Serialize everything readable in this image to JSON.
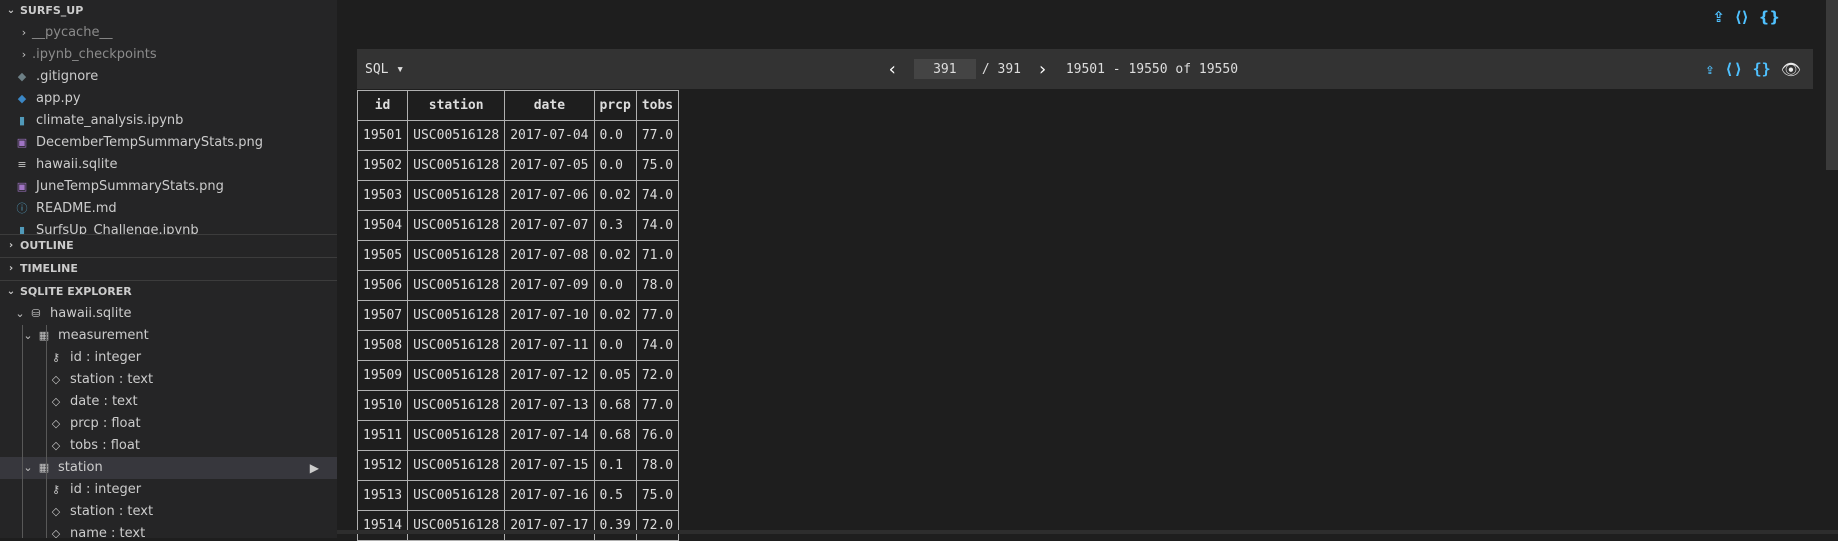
{
  "explorer": {
    "folder_title": "SURFS_UP",
    "files": [
      {
        "label": "__pycache__",
        "type": "folder",
        "icon": "chevron-right-icon"
      },
      {
        "label": ".ipynb_checkpoints",
        "type": "folder",
        "icon": "chevron-right-icon"
      },
      {
        "label": ".gitignore",
        "type": "file",
        "icon": "git-icon"
      },
      {
        "label": "app.py",
        "type": "file",
        "icon": "python-icon"
      },
      {
        "label": "climate_analysis.ipynb",
        "type": "file",
        "icon": "notebook-icon"
      },
      {
        "label": "DecemberTempSummaryStats.png",
        "type": "file",
        "icon": "image-icon"
      },
      {
        "label": "hawaii.sqlite",
        "type": "file",
        "icon": "lines-icon"
      },
      {
        "label": "JuneTempSummaryStats.png",
        "type": "file",
        "icon": "image-icon"
      },
      {
        "label": "README.md",
        "type": "file",
        "icon": "info-icon"
      },
      {
        "label": "SurfsUp_Challenge.ipynb",
        "type": "file",
        "icon": "notebook-icon"
      }
    ]
  },
  "outline": {
    "title": "OUTLINE"
  },
  "timeline": {
    "title": "TIMELINE"
  },
  "sqlite_explorer": {
    "title": "SQLITE EXPLORER",
    "database": "hawaii.sqlite",
    "tables": [
      {
        "name": "measurement",
        "columns": [
          "id : integer",
          "station : text",
          "date : text",
          "prcp : float",
          "tobs : float"
        ]
      },
      {
        "name": "station",
        "columns": [
          "id : integer",
          "station : text",
          "name : text"
        ]
      }
    ]
  },
  "sql_bar": {
    "label": "SQL ▾",
    "page_value": "391",
    "page_total": "/ 391",
    "range": "19501 - 19550 of 19550"
  },
  "results": {
    "columns": [
      "id",
      "station",
      "date",
      "prcp",
      "tobs"
    ],
    "rows": [
      [
        "19501",
        "USC00516128",
        "2017-07-04",
        "0.0",
        "77.0"
      ],
      [
        "19502",
        "USC00516128",
        "2017-07-05",
        "0.0",
        "75.0"
      ],
      [
        "19503",
        "USC00516128",
        "2017-07-06",
        "0.02",
        "74.0"
      ],
      [
        "19504",
        "USC00516128",
        "2017-07-07",
        "0.3",
        "74.0"
      ],
      [
        "19505",
        "USC00516128",
        "2017-07-08",
        "0.02",
        "71.0"
      ],
      [
        "19506",
        "USC00516128",
        "2017-07-09",
        "0.0",
        "78.0"
      ],
      [
        "19507",
        "USC00516128",
        "2017-07-10",
        "0.02",
        "77.0"
      ],
      [
        "19508",
        "USC00516128",
        "2017-07-11",
        "0.0",
        "74.0"
      ],
      [
        "19509",
        "USC00516128",
        "2017-07-12",
        "0.05",
        "72.0"
      ],
      [
        "19510",
        "USC00516128",
        "2017-07-13",
        "0.68",
        "77.0"
      ],
      [
        "19511",
        "USC00516128",
        "2017-07-14",
        "0.68",
        "76.0"
      ],
      [
        "19512",
        "USC00516128",
        "2017-07-15",
        "0.1",
        "78.0"
      ],
      [
        "19513",
        "USC00516128",
        "2017-07-16",
        "0.5",
        "75.0"
      ],
      [
        "19514",
        "USC00516128",
        "2017-07-17",
        "0.39",
        "72.0"
      ]
    ]
  },
  "colors": {
    "accent_icon": "#4fc1ff",
    "sidebar_bg": "#252526",
    "editor_bg": "#1e1e1e"
  }
}
